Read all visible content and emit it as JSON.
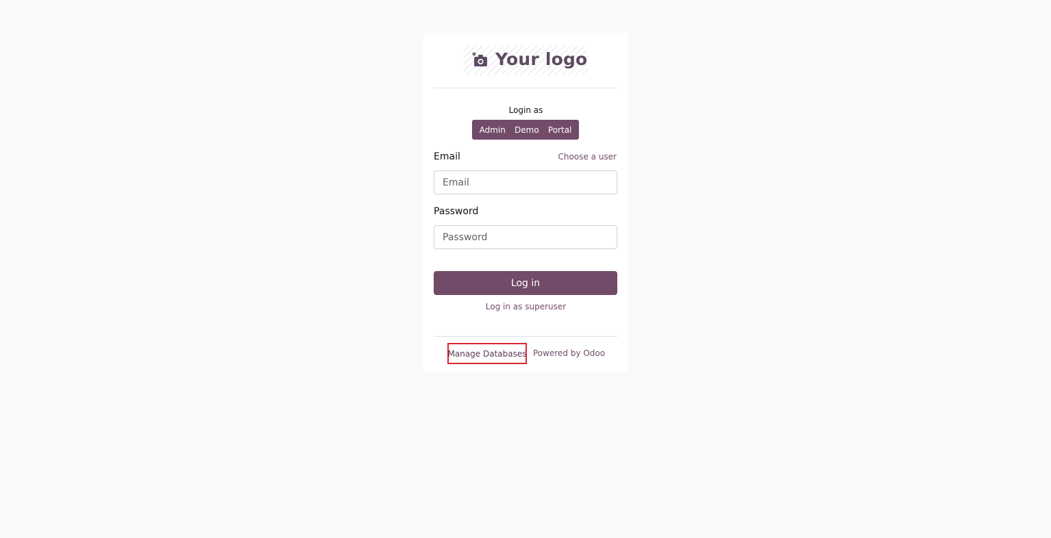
{
  "logo": {
    "text": "Your logo",
    "icon": "camera-plus-icon",
    "color": "#5f4a63"
  },
  "login_as": {
    "label": "Login as",
    "options": [
      "Admin",
      "Demo",
      "Portal"
    ]
  },
  "form": {
    "email_label": "Email",
    "choose_user": "Choose a user",
    "email_placeholder": "Email",
    "password_label": "Password",
    "password_placeholder": "Password",
    "login_button": "Log in",
    "superuser_link": "Log in as superuser"
  },
  "footer": {
    "manage_databases": "Manage Databases",
    "powered_by": "Powered by Odoo"
  },
  "colors": {
    "accent": "#714b67",
    "page_background": "#f8f9fa",
    "highlight_border": "#d9262e"
  }
}
